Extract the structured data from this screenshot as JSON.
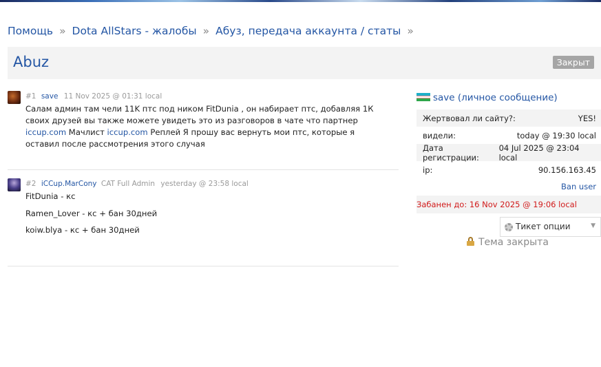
{
  "breadcrumb": {
    "items": [
      "Помощь",
      "Dota AllStars - жалобы",
      "Абуз, передача аккаунта / статы"
    ],
    "separator": "»"
  },
  "topic": {
    "title": "Abuz",
    "status_badge": "Закрыт"
  },
  "posts": [
    {
      "number": "#1",
      "author": "save",
      "rank": "",
      "date": "11 Nov 2025 @ 01:31 local",
      "body": {
        "part1": "Салам админ там чели 11K птс под ником FitDunia , он набирает птс, добавляя 1К своих друзей вы также можете увидеть это из разговоров в чате что партнер ",
        "link1": "iccup.com",
        "part2": " Мачлист ",
        "link2": "iccup.com",
        "part3": " Реплей Я прошу вас вернуть мои птс, которые я оставил после рассмотрения этого случая"
      }
    },
    {
      "number": "#2",
      "author": "iCCup.MarCony",
      "rank": "CAT Full Admin",
      "date": "yesterday @ 23:58 local",
      "lines": [
        "FitDunia - кс",
        "Ramen_Lover - кс + бан 30дней",
        "koiw.blya - кс + бан 30дней"
      ]
    }
  ],
  "user_panel": {
    "name": "save",
    "pm_label": "(личное сообщение)",
    "flag_icon": "uzbekistan-flag",
    "rows": [
      {
        "label": "Жертвовал ли сайту?:",
        "value": "YES!"
      },
      {
        "label": "видели:",
        "value": "today @ 19:30 local"
      },
      {
        "label": "Дата регистрации:",
        "value": "04 Jul 2025 @ 23:04 local"
      },
      {
        "label": "ip:",
        "value": "90.156.163.45"
      }
    ],
    "ban_user": "Ban user",
    "banned_until": "Забанен до: 16 Nov 2025 @ 19:06 local"
  },
  "ticket_options": {
    "label": "Тикет опции",
    "icon": "gear-icon"
  },
  "topic_closed": {
    "label": "Тема закрыта",
    "icon": "lock-icon"
  },
  "colors": {
    "link": "#2456a4",
    "ban_text": "#d11a1a",
    "badge_bg": "#a5a5a5",
    "stripe_bg": "#f3f3f3"
  }
}
